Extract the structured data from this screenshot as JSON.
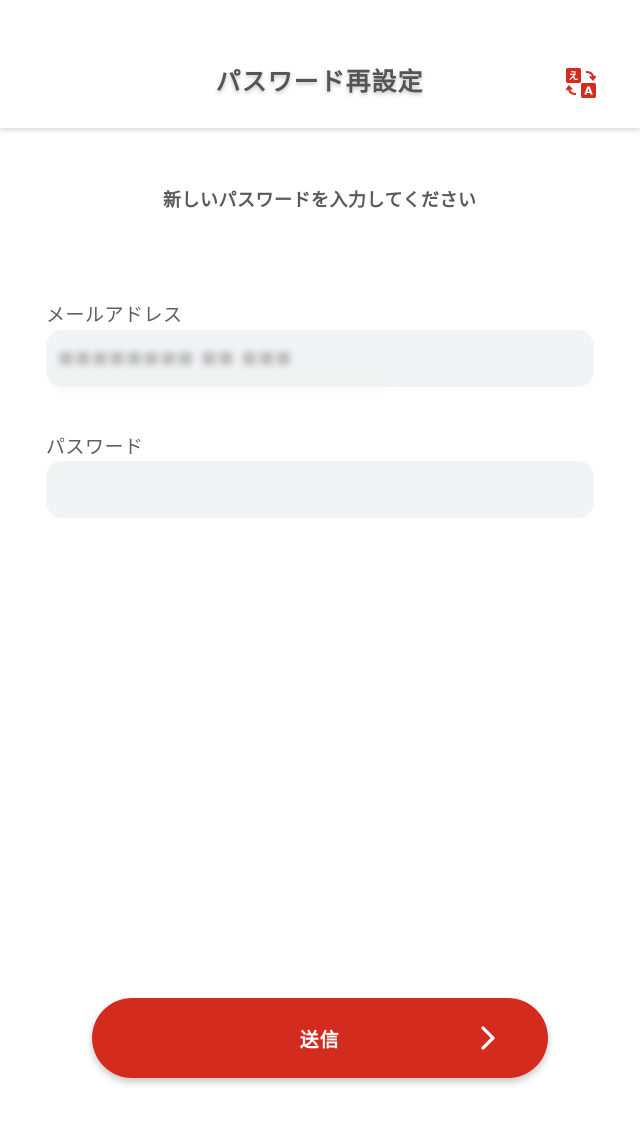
{
  "header": {
    "title": "パスワード再設定",
    "translate_icon": "translate-icon"
  },
  "instruction": "新しいパスワードを入力してください",
  "form": {
    "email_label": "メールアドレス",
    "email_value": "■■■■■■■■ ■■ ■■■",
    "password_label": "パスワード",
    "password_value": ""
  },
  "submit": {
    "label": "送信",
    "icon": "chevron-right-icon"
  },
  "colors": {
    "accent": "#d32c1f",
    "field_bg": "#f2f3f5",
    "text": "#5a5a5a"
  }
}
